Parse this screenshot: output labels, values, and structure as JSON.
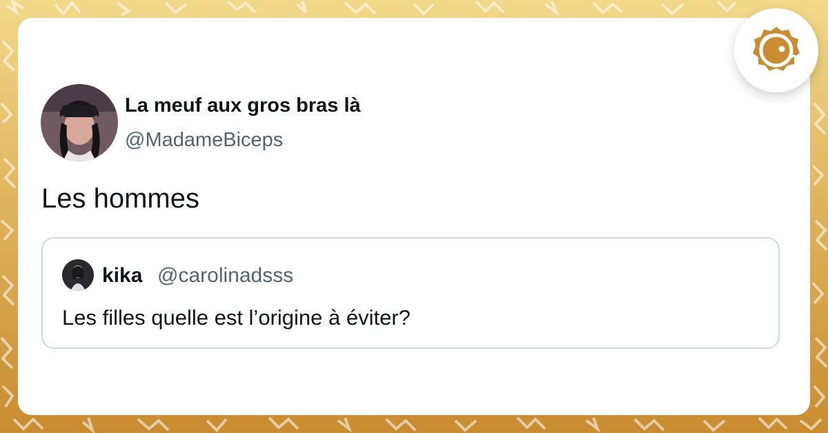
{
  "tweet": {
    "display_name": "La meuf aux gros bras là",
    "handle": "@MadameBiceps",
    "text": "Les hommes"
  },
  "quoted_tweet": {
    "display_name": "kika",
    "handle": "@carolinadsss",
    "text": "Les filles quelle est l’origine à éviter?"
  },
  "brand": {
    "logo_icon": "bird-face-logo-icon",
    "accent_color": "#c98c30"
  },
  "colors": {
    "background_top": "#f2d98a",
    "background_bottom": "#c98c30",
    "text_primary": "#0f1419",
    "text_secondary": "#536471",
    "quote_border": "#cfd9de"
  }
}
